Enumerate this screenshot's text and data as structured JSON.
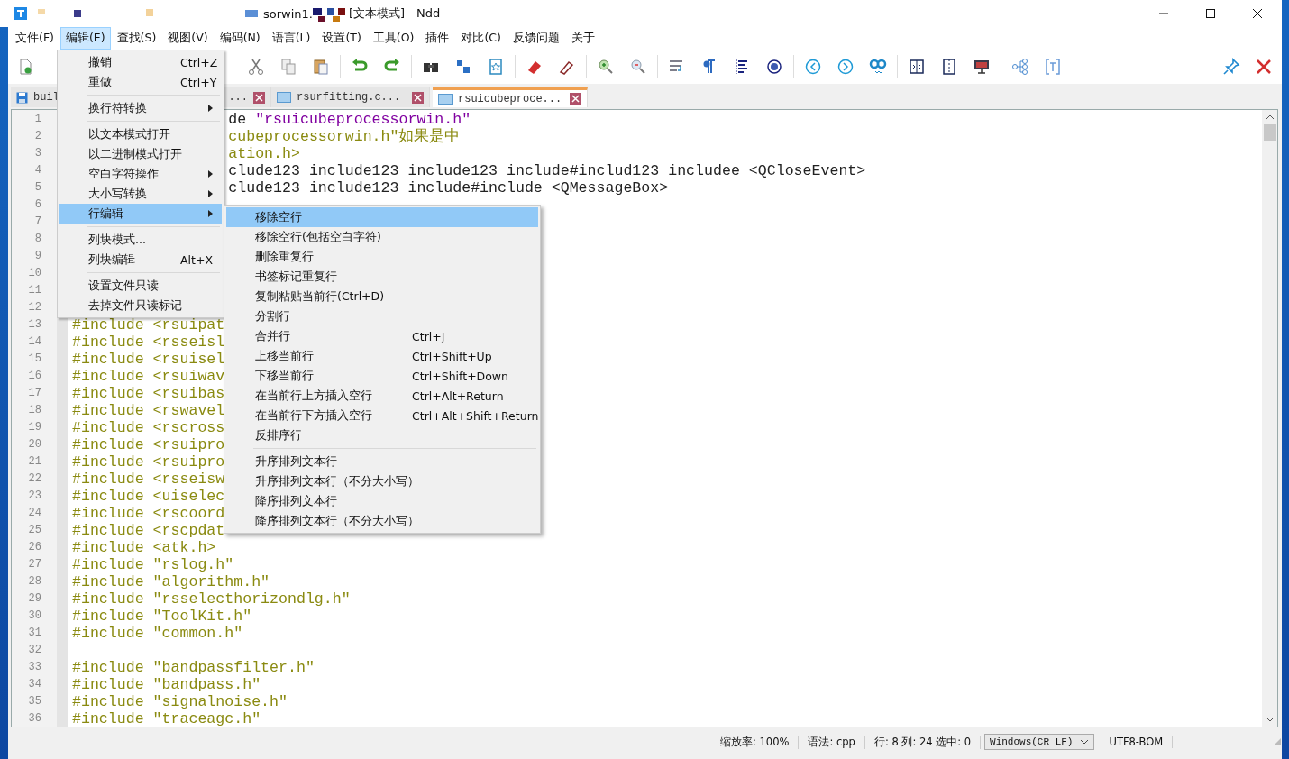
{
  "window": {
    "title_start": "sorwin1.",
    "title_end": "[文本模式] - Ndd"
  },
  "menu_bar": [
    {
      "label": "文件(F)",
      "selected": false
    },
    {
      "label": "编辑(E)",
      "selected": true
    },
    {
      "label": "查找(S)",
      "selected": false
    },
    {
      "label": "视图(V)",
      "selected": false
    },
    {
      "label": "编码(N)",
      "selected": false
    },
    {
      "label": "语言(L)",
      "selected": false
    },
    {
      "label": "设置(T)",
      "selected": false
    },
    {
      "label": "工具(O)",
      "selected": false
    },
    {
      "label": "插件",
      "selected": false
    },
    {
      "label": "对比(C)",
      "selected": false
    },
    {
      "label": "反馈问题",
      "selected": false
    },
    {
      "label": "关于",
      "selected": false
    }
  ],
  "tabs": [
    {
      "label": "buil",
      "label_end": "...",
      "selected": false
    },
    {
      "label": "rsurfitting.c...",
      "selected": false
    },
    {
      "label": "rsuicubeproce...",
      "selected": true
    }
  ],
  "editor": {
    "lines": [
      {
        "number": "1",
        "covered": true,
        "segments": [
          {
            "kind": "plain",
            "text": "de "
          },
          {
            "kind": "string",
            "text": "\"rsuicubeprocessorwin.h\""
          }
        ]
      },
      {
        "number": "2",
        "covered": true,
        "segments": [
          {
            "kind": "directive",
            "text": "cubeprocessorwin.h\"如果是中"
          }
        ]
      },
      {
        "number": "3",
        "covered": true,
        "segments": [
          {
            "kind": "directive",
            "text": "ation.h>"
          }
        ]
      },
      {
        "number": "4",
        "covered": true,
        "segments": [
          {
            "kind": "plain",
            "text": "clude123 include123 include123 include#includ123 includee <QCloseEvent>"
          }
        ]
      },
      {
        "number": "5",
        "covered": true,
        "segments": [
          {
            "kind": "plain",
            "text": "clude123 include123 include#include <QMessageBox>"
          }
        ]
      },
      {
        "number": "6"
      },
      {
        "number": "7"
      },
      {
        "number": "8"
      },
      {
        "number": "9"
      },
      {
        "number": "10"
      },
      {
        "number": "11"
      },
      {
        "number": "12"
      },
      {
        "number": "13",
        "covered": false,
        "segments": [
          {
            "kind": "directive",
            "text": "#include <rsuipat"
          }
        ]
      },
      {
        "number": "14",
        "covered": false,
        "segments": [
          {
            "kind": "directive",
            "text": "#include <rsseisl"
          }
        ]
      },
      {
        "number": "15",
        "covered": false,
        "segments": [
          {
            "kind": "directive",
            "text": "#include <rsuisel"
          }
        ]
      },
      {
        "number": "16",
        "covered": false,
        "segments": [
          {
            "kind": "directive",
            "text": "#include <rsuiwav"
          }
        ]
      },
      {
        "number": "17",
        "covered": false,
        "segments": [
          {
            "kind": "directive",
            "text": "#include <rsuibas"
          }
        ]
      },
      {
        "number": "18",
        "covered": false,
        "segments": [
          {
            "kind": "directive",
            "text": "#include <rswavel"
          }
        ]
      },
      {
        "number": "19",
        "covered": false,
        "segments": [
          {
            "kind": "directive",
            "text": "#include <rscross"
          }
        ]
      },
      {
        "number": "20",
        "covered": false,
        "segments": [
          {
            "kind": "directive",
            "text": "#include <rsuipro"
          }
        ]
      },
      {
        "number": "21",
        "covered": false,
        "segments": [
          {
            "kind": "directive",
            "text": "#include <rsuipro"
          }
        ]
      },
      {
        "number": "22",
        "covered": false,
        "segments": [
          {
            "kind": "directive",
            "text": "#include <rsseisw"
          }
        ]
      },
      {
        "number": "23",
        "covered": false,
        "segments": [
          {
            "kind": "directive",
            "text": "#include <uiselec"
          }
        ]
      },
      {
        "number": "24",
        "covered": false,
        "segments": [
          {
            "kind": "directive",
            "text": "#include <rscoord"
          }
        ]
      },
      {
        "number": "25",
        "covered": false,
        "segments": [
          {
            "kind": "directive",
            "text": "#include <rscpdat"
          }
        ]
      },
      {
        "number": "26",
        "covered": false,
        "segments": [
          {
            "kind": "directive",
            "text": "#include <atk.h>"
          }
        ]
      },
      {
        "number": "27",
        "covered": false,
        "segments": [
          {
            "kind": "directive",
            "text": "#include \"rslog.h\""
          }
        ]
      },
      {
        "number": "28",
        "covered": false,
        "segments": [
          {
            "kind": "directive",
            "text": "#include \"algorithm.h\""
          }
        ]
      },
      {
        "number": "29",
        "covered": false,
        "segments": [
          {
            "kind": "directive",
            "text": "#include \"rsselecthorizondlg.h\""
          }
        ]
      },
      {
        "number": "30",
        "covered": false,
        "segments": [
          {
            "kind": "directive",
            "text": "#include \"ToolKit.h\""
          }
        ]
      },
      {
        "number": "31",
        "covered": false,
        "segments": [
          {
            "kind": "directive",
            "text": "#include \"common.h\""
          }
        ]
      },
      {
        "number": "32"
      },
      {
        "number": "33",
        "covered": false,
        "segments": [
          {
            "kind": "directive",
            "text": "#include \"bandpassfilter.h\""
          }
        ]
      },
      {
        "number": "34",
        "covered": false,
        "segments": [
          {
            "kind": "directive",
            "text": "#include \"bandpass.h\""
          }
        ]
      },
      {
        "number": "35",
        "covered": false,
        "segments": [
          {
            "kind": "directive",
            "text": "#include \"signalnoise.h\""
          }
        ]
      },
      {
        "number": "36",
        "covered": false,
        "segments": [
          {
            "kind": "directive",
            "text": "#include \"traceagc.h\""
          }
        ]
      }
    ]
  },
  "edit_menu": {
    "items": [
      {
        "kind": "item",
        "label": "撤销",
        "shortcut": "Ctrl+Z",
        "selected": false
      },
      {
        "kind": "item",
        "label": "重做",
        "shortcut": "Ctrl+Y",
        "selected": false
      },
      {
        "kind": "separator"
      },
      {
        "kind": "submenu",
        "label": "换行符转换",
        "selected": false
      },
      {
        "kind": "separator"
      },
      {
        "kind": "item",
        "label": "以文本模式打开",
        "selected": false
      },
      {
        "kind": "item",
        "label": "以二进制模式打开",
        "selected": false
      },
      {
        "kind": "submenu",
        "label": "空白字符操作",
        "selected": false
      },
      {
        "kind": "submenu",
        "label": "大小写转换",
        "selected": false
      },
      {
        "kind": "submenu",
        "label": "行编辑",
        "selected": true
      },
      {
        "kind": "separator"
      },
      {
        "kind": "item",
        "label": "列块模式...",
        "selected": false
      },
      {
        "kind": "item",
        "label": "列块编辑",
        "shortcut": "Alt+X",
        "selected": false
      },
      {
        "kind": "separator"
      },
      {
        "kind": "item",
        "label": "设置文件只读",
        "selected": false
      },
      {
        "kind": "item",
        "label": "去掉文件只读标记",
        "selected": false
      }
    ]
  },
  "line_edit_submenu": {
    "items": [
      {
        "kind": "item",
        "label": "移除空行",
        "selected": true
      },
      {
        "kind": "item",
        "label": "移除空行(包括空白字符)",
        "selected": false
      },
      {
        "kind": "item",
        "label": "删除重复行",
        "selected": false
      },
      {
        "kind": "item",
        "label": "书签标记重复行",
        "selected": false
      },
      {
        "kind": "item",
        "label": "复制粘贴当前行(Ctrl+D)",
        "selected": false
      },
      {
        "kind": "item",
        "label": "分割行",
        "selected": false
      },
      {
        "kind": "item",
        "label": "合并行",
        "shortcut": "Ctrl+J",
        "selected": false
      },
      {
        "kind": "item",
        "label": "上移当前行",
        "shortcut": "Ctrl+Shift+Up",
        "selected": false
      },
      {
        "kind": "item",
        "label": "下移当前行",
        "shortcut": "Ctrl+Shift+Down",
        "selected": false
      },
      {
        "kind": "item",
        "label": "在当前行上方插入空行",
        "shortcut": "Ctrl+Alt+Return",
        "selected": false
      },
      {
        "kind": "item",
        "label": "在当前行下方插入空行",
        "shortcut": "Ctrl+Alt+Shift+Return",
        "selected": false
      },
      {
        "kind": "item",
        "label": "反排序行",
        "selected": false
      },
      {
        "kind": "separator"
      },
      {
        "kind": "item",
        "label": "升序排列文本行",
        "selected": false
      },
      {
        "kind": "item",
        "label": "升序排列文本行（不分大小写）",
        "selected": false
      },
      {
        "kind": "item",
        "label": "降序排列文本行",
        "selected": false
      },
      {
        "kind": "item",
        "label": "降序排列文本行（不分大小写）",
        "selected": false
      }
    ]
  },
  "status_bar": {
    "zoom": "缩放率: 100%",
    "syntax": "语法: cpp",
    "position": "行: 8 列: 24 选中: 0",
    "line_ending": "Windows(CR LF)",
    "encoding": "UTF8-BOM"
  }
}
